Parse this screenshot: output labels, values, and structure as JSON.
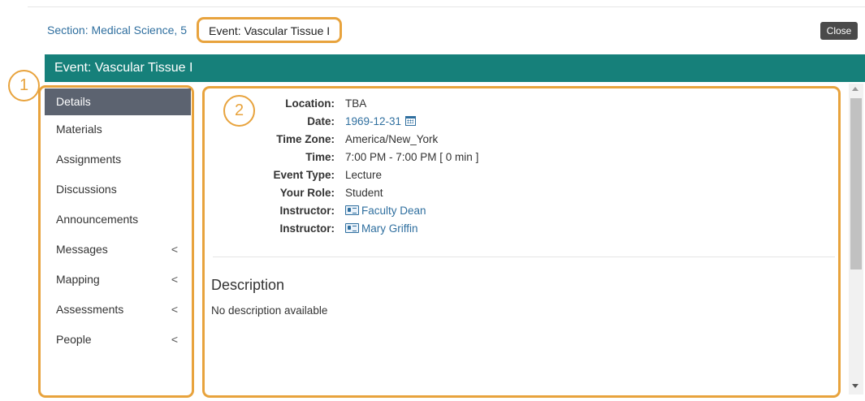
{
  "breadcrumb": {
    "section_link": "Section: Medical Science, 5",
    "current": "Event: Vascular Tissue I"
  },
  "close_label": "Close",
  "event_header": "Event: Vascular Tissue I",
  "callouts": {
    "one": "1",
    "two": "2"
  },
  "nav": {
    "items": [
      {
        "label": "Details",
        "active": true
      },
      {
        "label": "Materials"
      },
      {
        "label": "Assignments"
      },
      {
        "label": "Discussions"
      },
      {
        "label": "Announcements"
      },
      {
        "label": "Messages",
        "chevron": "<"
      },
      {
        "label": "Mapping",
        "chevron": "<"
      },
      {
        "label": "Assessments",
        "chevron": "<"
      },
      {
        "label": "People",
        "chevron": "<"
      }
    ]
  },
  "details": {
    "location_label": "Location:",
    "location": "TBA",
    "date_label": "Date:",
    "date": "1969-12-31",
    "timezone_label": "Time Zone:",
    "timezone": "America/New_York",
    "time_label": "Time:",
    "time": "7:00 PM - 7:00 PM [ 0 min ]",
    "event_type_label": "Event Type:",
    "event_type": "Lecture",
    "role_label": "Your Role:",
    "role": "Student",
    "instructor_label": "Instructor:",
    "instructors": [
      "Faculty Dean",
      "Mary Griffin"
    ]
  },
  "description": {
    "title": "Description",
    "text": "No description available"
  },
  "colors": {
    "accent": "#16807a",
    "highlight": "#e8a33d",
    "link": "#2f6f9f",
    "nav_active": "#5c6370"
  }
}
